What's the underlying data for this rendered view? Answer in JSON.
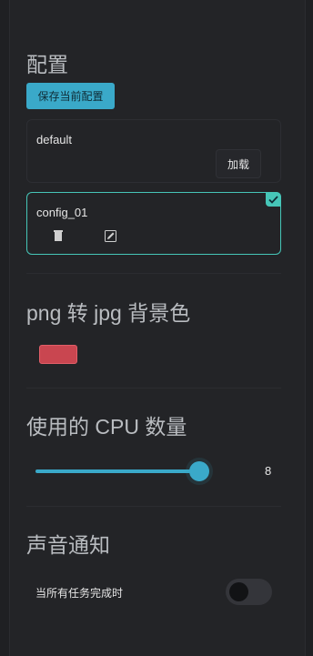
{
  "sections": {
    "config": {
      "title": "配置",
      "save_button": "保存当前配置",
      "items": [
        {
          "name": "default",
          "load_button": "加载",
          "selected": false
        },
        {
          "name": "config_01",
          "selected": true
        }
      ]
    },
    "png_to_jpg": {
      "title": "png 转 jpg 背景色",
      "color": "#c94650"
    },
    "cpu": {
      "title": "使用的 CPU 数量",
      "value": "8",
      "fraction": 0.9
    },
    "sound": {
      "title": "声音通知",
      "toggle_label": "当所有任务完成时",
      "toggle_on": false
    }
  },
  "colors": {
    "accent": "#3aa9c9",
    "active_border": "#46c6b8",
    "swatch": "#c94650"
  }
}
